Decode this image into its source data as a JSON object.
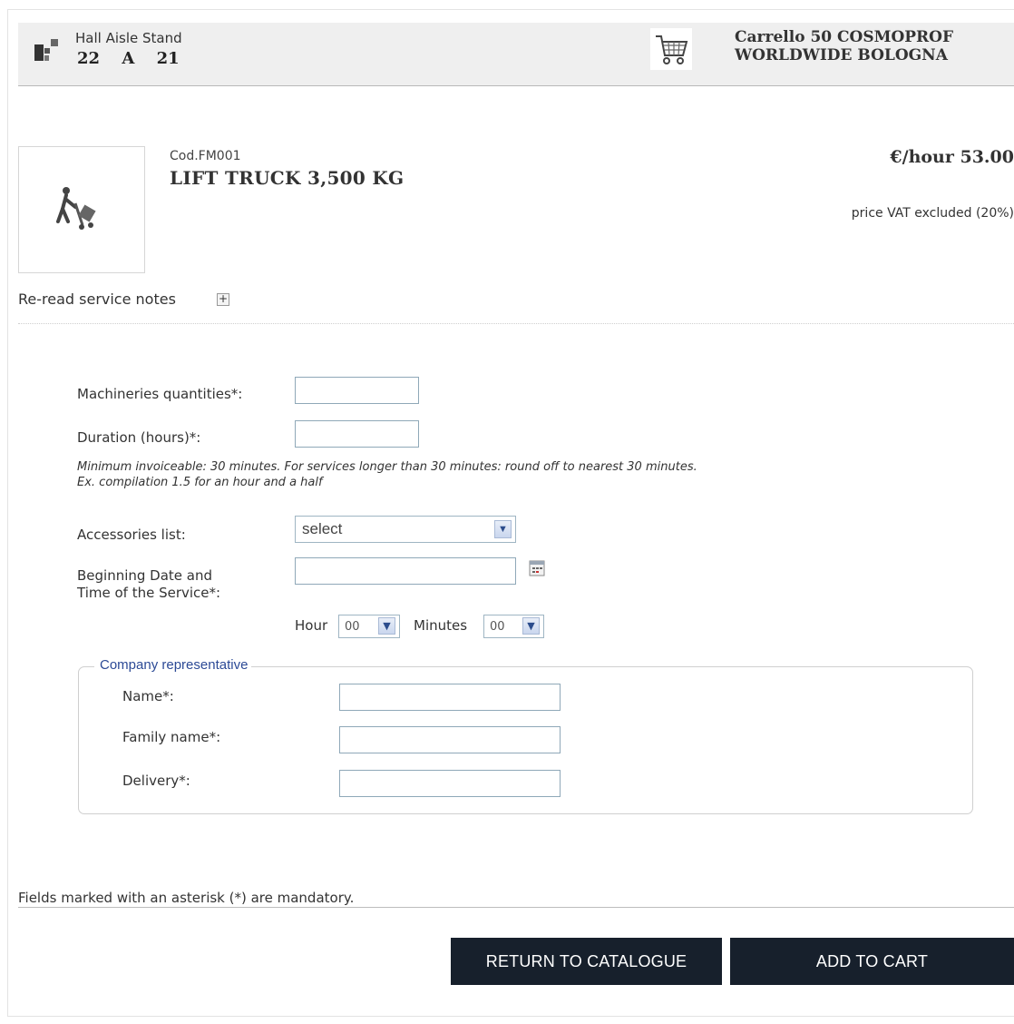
{
  "header": {
    "hall_label": "Hall Aisle Stand",
    "hall": "22",
    "aisle": "A",
    "stand": "21",
    "cart_line1": "Carrello 50 COSMOPROF",
    "cart_line2": "WORLDWIDE BOLOGNA"
  },
  "product": {
    "code": "Cod.FM001",
    "title": "LIFT TRUCK 3,500 KG",
    "price": "€/hour 53.00",
    "vat_note": "price VAT excluded (20%)",
    "notes_link": "Re-read service notes",
    "notes_toggle": "+"
  },
  "form": {
    "quantities_label": "Machineries quantities*:",
    "quantities_value": "",
    "duration_label": "Duration (hours)*:",
    "duration_value": "",
    "hint_line1": "Minimum invoiceable: 30 minutes. For services longer than 30 minutes: round off to nearest 30 minutes.",
    "hint_line2": "Ex. compilation 1.5 for an hour and a half",
    "accessories_label": "Accessories list:",
    "accessories_selected": "select",
    "begin_label_line1": "Beginning Date and",
    "begin_label_line2": "Time of the Service*:",
    "begin_value": "",
    "hour_label": "Hour",
    "hour_value": "00",
    "minutes_label": "Minutes",
    "minutes_value": "00"
  },
  "representative": {
    "legend": "Company representative",
    "name_label": "Name*:",
    "name_value": "",
    "family_label": "Family name*:",
    "family_value": "",
    "delivery_label": "Delivery*:",
    "delivery_value": ""
  },
  "footer": {
    "mandatory_note": "Fields marked with an asterisk (*) are mandatory.",
    "return_button": "RETURN TO CATALOGUE",
    "add_button": "ADD TO CART"
  },
  "colors": {
    "button_bg": "#17202c",
    "legend_text": "#2c4a96",
    "header_bg": "#efefef"
  }
}
